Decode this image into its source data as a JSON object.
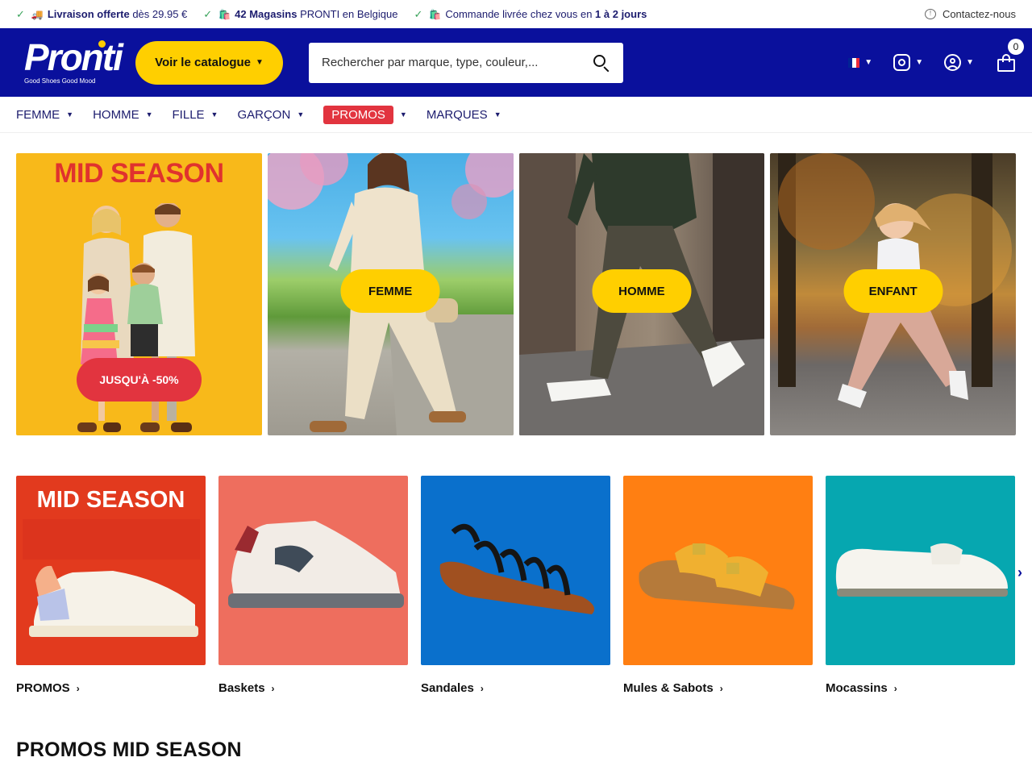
{
  "topbar": {
    "usp1_bold": "Livraison offerte",
    "usp1_rest": " dès 29.95 €",
    "usp2_bold": "42 Magasins",
    "usp2_rest": " PRONTI en Belgique",
    "usp3_pre": "Commande livrée chez vous en ",
    "usp3_bold": "1 à 2 jours",
    "contact": "Contactez-nous"
  },
  "header": {
    "logo_text": "Pronti",
    "logo_tagline": "Good Shoes Good Mood",
    "catalog_label": "Voir le catalogue",
    "search_placeholder": "Rechercher par marque, type, couleur,...",
    "cart_count": "0",
    "brand_color": "#0a109c",
    "accent_color": "#ffcf00"
  },
  "nav": {
    "items": [
      "FEMME",
      "HOMME",
      "FILLE",
      "GARÇON",
      "PROMOS",
      "MARQUES"
    ]
  },
  "hero": {
    "promo_heading": "MID SEASON",
    "promo_button": "JUSQU'À -50%",
    "femme_button": "FEMME",
    "homme_button": "HOMME",
    "enfant_button": "ENFANT"
  },
  "categories": {
    "promo_image_heading": "MID SEASON",
    "items": [
      "PROMOS",
      "Baskets",
      "Sandales",
      "Mules & Sabots",
      "Mocassins"
    ]
  },
  "section_title": "PROMOS MID SEASON"
}
